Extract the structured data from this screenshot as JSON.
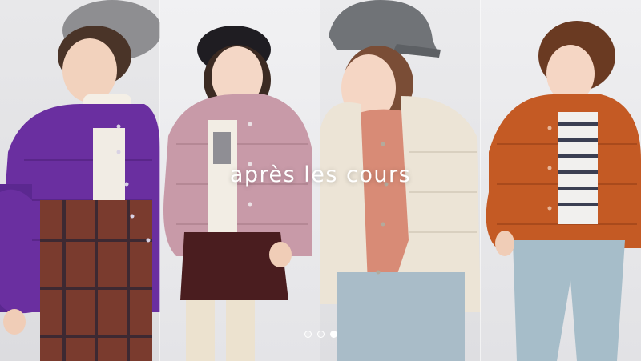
{
  "hero": {
    "title": "après les cours",
    "slides": [
      {
        "name": "slide-1",
        "active": false
      },
      {
        "name": "slide-2",
        "active": false
      },
      {
        "name": "slide-3",
        "active": true
      }
    ]
  },
  "colors": {
    "purple_jacket": "#6a2fa0",
    "pink_jacket": "#c99aa9",
    "cream_jacket": "#ece4d6",
    "orange_jacket": "#c45a24",
    "title_text": "#ffffff"
  }
}
